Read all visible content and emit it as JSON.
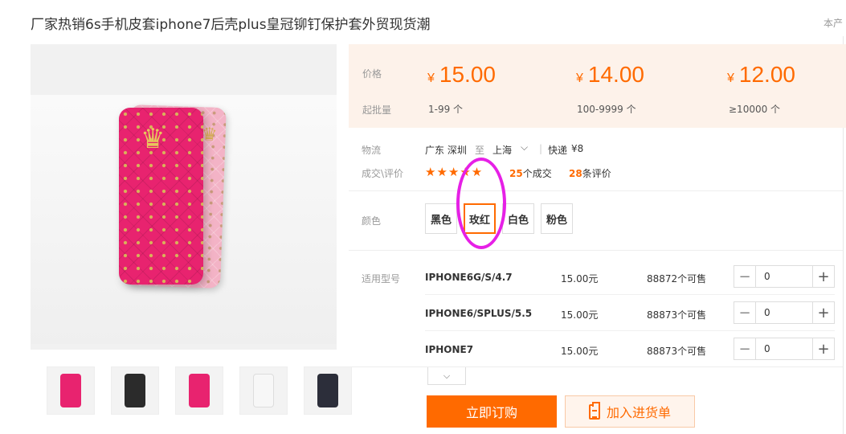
{
  "product": {
    "title": "厂家热销6s手机皮套iphone7后壳plus皇冠铆钉保护套外贸现货潮",
    "corner_text": "本产"
  },
  "gallery": {
    "main_image": "pink-and-rose-quilted-phone-cases-photo",
    "thumbnails": [
      {
        "icon": "rose-case-thumb",
        "color": "#e8236f"
      },
      {
        "icon": "black-case-thumb",
        "color": "#2b2b2b"
      },
      {
        "icon": "rose-case-thumb",
        "color": "#e8236f"
      },
      {
        "icon": "white-case-thumb",
        "color": "#f4f4f4"
      },
      {
        "icon": "navy-case-thumb",
        "color": "#2c2e3a"
      }
    ]
  },
  "pricing": {
    "price_label": "价格",
    "qty_label": "起批量",
    "currency": "¥",
    "tiers": [
      {
        "price": "15.00",
        "qty": "1-99 个"
      },
      {
        "price": "14.00",
        "qty": "100-9999 个"
      },
      {
        "price": "12.00",
        "qty": "≥10000 个"
      }
    ]
  },
  "shipping": {
    "label": "物流",
    "from": "广东 深圳",
    "to_word": "至",
    "destination": "上海",
    "method": "快递",
    "fee": "¥8"
  },
  "reviews": {
    "label": "成交\\评价",
    "stars": "★★★★★",
    "deals_count": "25",
    "deals_suffix": "个成交",
    "reviews_count": "28",
    "reviews_suffix": "条评价"
  },
  "colors": {
    "label": "颜色",
    "options": [
      "黑色",
      "玫红",
      "白色",
      "粉色"
    ],
    "selected": "玫红"
  },
  "models": {
    "label": "适用型号",
    "rows": [
      {
        "name": "IPHONE6G/S/4.7",
        "price": "15.00元",
        "stock": "88872个可售",
        "qty": "0"
      },
      {
        "name": "IPHONE6/SPLUS/5.5",
        "price": "15.00元",
        "stock": "88873个可售",
        "qty": "0"
      },
      {
        "name": "IPHONE7",
        "price": "15.00元",
        "stock": "88873个可售",
        "qty": "0"
      }
    ]
  },
  "actions": {
    "buy_now": "立即订购",
    "add_to_cart": "加入进货单"
  },
  "theme": {
    "accent": "#ff6a00",
    "annotation": "#e620e6"
  }
}
